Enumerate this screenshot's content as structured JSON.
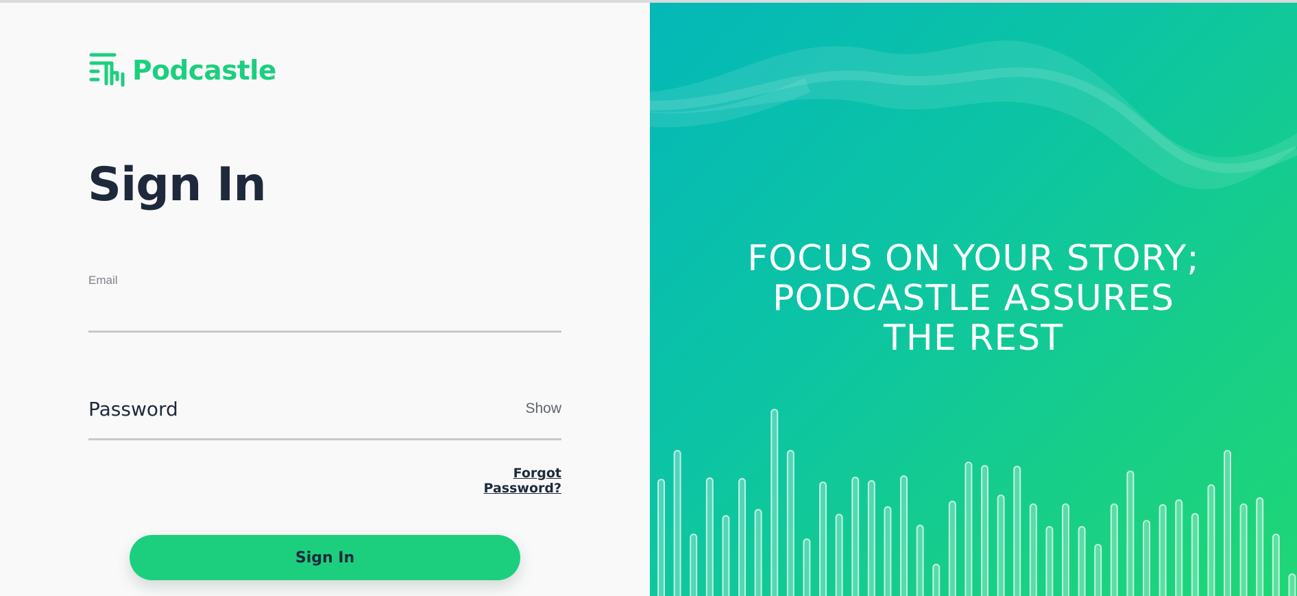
{
  "brand": {
    "name": "Podcastle",
    "logo_icon": "podcastle-waveform-icon",
    "accent_color": "#1ccf7e",
    "text_color": "#1e2a3b"
  },
  "signin": {
    "title": "Sign In",
    "email": {
      "label": "Email",
      "value": ""
    },
    "password": {
      "placeholder": "Password",
      "show_label": "Show"
    },
    "forgot_label": "Forgot Password?",
    "submit_label": "Sign In"
  },
  "hero": {
    "tagline_lines": [
      "FOCUS ON YOUR STORY;",
      "PODCASTLE ASSURES",
      "THE REST"
    ],
    "gradient": [
      "#04b8b8",
      "#1fd676"
    ],
    "decor_icon": "audio-bars-icon"
  }
}
